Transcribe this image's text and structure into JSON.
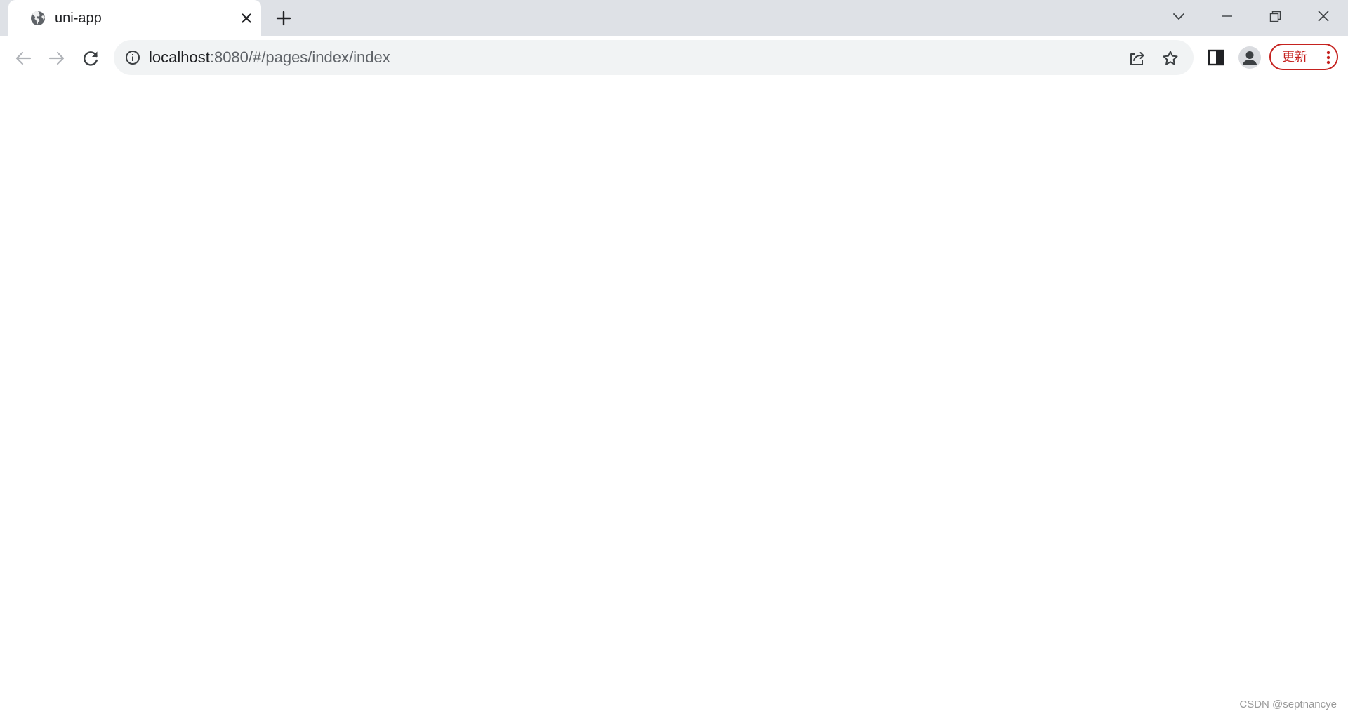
{
  "tab": {
    "title": "uni-app",
    "favicon_icon": "globe-icon",
    "close_icon": "close-icon"
  },
  "tabstrip": {
    "new_tab_icon": "plus-icon",
    "search_tabs_icon": "chevron-down-icon"
  },
  "window_controls": {
    "minimize_icon": "minimize-icon",
    "restore_icon": "restore-icon",
    "close_icon": "close-icon"
  },
  "toolbar": {
    "back_icon": "arrow-left-icon",
    "forward_icon": "arrow-right-icon",
    "reload_icon": "reload-icon",
    "side_panel_icon": "side-panel-icon",
    "profile_icon": "avatar-icon",
    "update_label": "更新",
    "menu_icon": "kebab-menu-icon"
  },
  "omnibox": {
    "site_info_icon": "info-icon",
    "url_host": "localhost",
    "url_rest": ":8080/#/pages/index/index",
    "share_icon": "share-icon",
    "bookmark_icon": "star-icon"
  },
  "page": {
    "watermark": "CSDN @septnancye"
  },
  "colors": {
    "tabstrip_bg": "#dee1e6",
    "omnibox_bg": "#f1f3f4",
    "update_accent": "#c5221f"
  }
}
